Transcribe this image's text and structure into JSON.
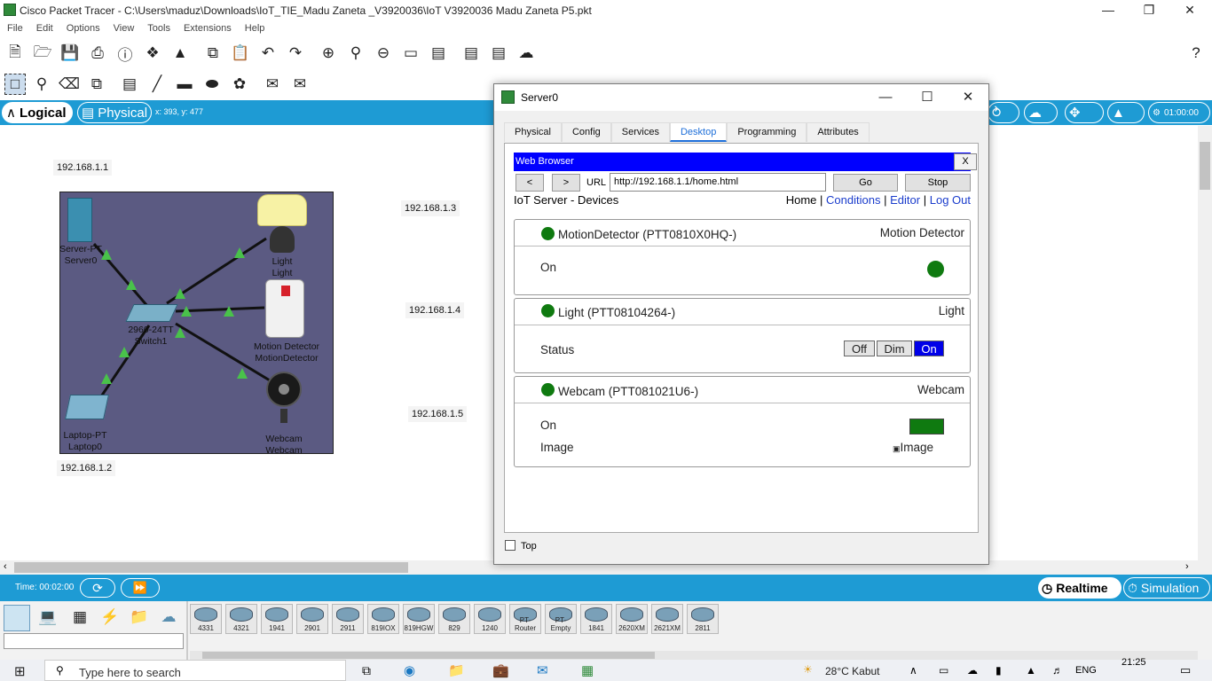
{
  "window": {
    "title": "Cisco Packet Tracer - C:\\Users\\maduz\\Downloads\\IoT_TIE_Madu Zaneta _V3920036\\IoT V3920036 Madu Zaneta  P5.pkt"
  },
  "menu": [
    "File",
    "Edit",
    "Options",
    "View",
    "Tools",
    "Extensions",
    "Help"
  ],
  "modebar": {
    "logical": "Logical",
    "physical": "Physical",
    "coords": "x: 393, y: 477",
    "clock": "01:00:00"
  },
  "topology": {
    "ips": [
      "192.168.1.1",
      "192.168.1.3",
      "192.168.1.4",
      "192.168.1.2",
      "192.168.1.5"
    ],
    "devices": {
      "server": [
        "Server-PT",
        "Server0"
      ],
      "switch": [
        "2960-24TT",
        "Switch1"
      ],
      "light": [
        "Light",
        "Light"
      ],
      "motion": [
        "Motion Detector",
        "MotionDetector"
      ],
      "laptop": [
        "Laptop-PT",
        "Laptop0"
      ],
      "webcam": [
        "Webcam",
        "Webcam"
      ]
    }
  },
  "bottom": {
    "time": "Time: 00:02:00",
    "realtime": "Realtime",
    "simulation": "Simulation"
  },
  "device_models": [
    "4331",
    "4321",
    "1941",
    "2901",
    "2911",
    "819IOX",
    "819HGW",
    "829",
    "1240",
    "PT-Router",
    "PT-Empty",
    "1841",
    "2620XM",
    "2621XM",
    "2811"
  ],
  "taskbar": {
    "search": "Type here to search",
    "weather": "28°C  Kabut",
    "lang": "ENG",
    "time": "21:25"
  },
  "dialog": {
    "title": "Server0",
    "tabs": [
      "Physical",
      "Config",
      "Services",
      "Desktop",
      "Programming",
      "Attributes"
    ],
    "active_tab": "Desktop",
    "top_checkbox": "Top",
    "browser": {
      "title": "Web Browser",
      "close": "X",
      "back": "<",
      "forward": ">",
      "url_label": "URL",
      "url": "http://192.168.1.1/home.html",
      "go": "Go",
      "stop": "Stop",
      "page_title": "IoT Server - Devices",
      "nav": {
        "home": "Home",
        "sep": "|",
        "conditions": "Conditions",
        "editor": "Editor",
        "logout": "Log Out"
      },
      "cards": {
        "motion": {
          "name": "MotionDetector (PTT0810X0HQ-)",
          "type": "Motion Detector",
          "row_label": "On",
          "state": "on"
        },
        "light": {
          "name": "Light (PTT08104264-)",
          "type": "Light",
          "row_label": "Status",
          "options": [
            "Off",
            "Dim",
            "On"
          ],
          "selected": "On"
        },
        "webcam": {
          "name": "Webcam (PTT081021U6-)",
          "type": "Webcam",
          "row1_label": "On",
          "row2_label": "Image",
          "image_alt": "Image"
        }
      }
    }
  },
  "colors": {
    "accent_blue": "#1e9bd4",
    "browser_head": "#0000ff",
    "status_green": "#0f7a10",
    "cluster_bg": "#5b5a82"
  }
}
